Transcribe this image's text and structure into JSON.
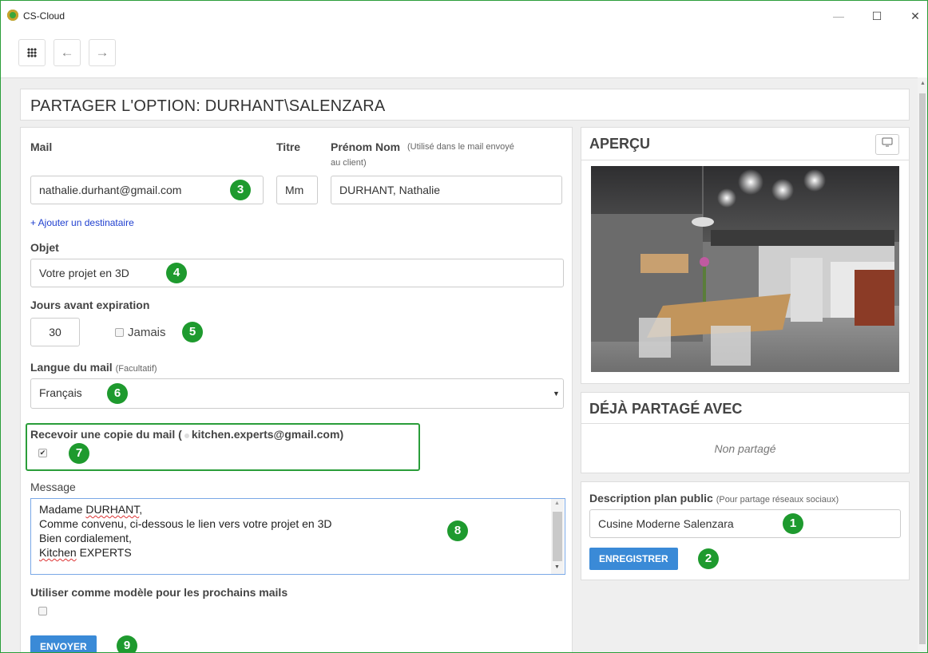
{
  "window": {
    "title": "CS-Cloud",
    "min": "—",
    "max": "☐",
    "close": "✕"
  },
  "toolbar": {
    "back": "←",
    "forward": "→"
  },
  "page": {
    "title": "PARTAGER L'OPTION: DURHANT\\SALENZARA"
  },
  "form": {
    "mail_label": "Mail",
    "titre_label": "Titre",
    "name_label": "Prénom Nom",
    "name_note": "(Utilisé dans le mail envoyé au client)",
    "mail_value": "nathalie.durhant@gmail.com",
    "titre_value": "Mm",
    "name_value": "DURHANT, Nathalie",
    "add_recipient": "+ Ajouter un destinataire",
    "objet_label": "Objet",
    "objet_value": "Votre projet en 3D",
    "expiration_label": "Jours avant expiration",
    "expiration_value": "30",
    "jamais_label": "Jamais",
    "langue_label": "Langue du mail",
    "langue_note": "(Facultatif)",
    "langue_value": "Français",
    "copy_label": "Recevoir une copie du mail (",
    "copy_email": "kitchen.experts@gmail.com",
    "copy_close": ")",
    "copy_checked": true,
    "message_label": "Message",
    "message_line1_a": "Madame ",
    "message_line1_b": "DURHANT",
    "message_line1_c": ",",
    "message_line2": "Comme convenu, ci-dessous le lien vers votre projet en 3D",
    "message_line3": "Bien cordialement,",
    "message_line4_a": "Kitchen",
    "message_line4_b": " EXPERTS",
    "template_label": "Utiliser comme modèle pour les prochains mails",
    "template_checked": false,
    "send_button": "ENVOYER"
  },
  "preview": {
    "title": "APERÇU",
    "icon": "monitor-icon"
  },
  "shared": {
    "title": "DÉJÀ PARTAGÉ AVEC",
    "empty": "Non partagé"
  },
  "description": {
    "label": "Description plan public",
    "note": "(Pour partage réseaux sociaux)",
    "value": "Cusine Moderne Salenzara",
    "save_button": "ENREGISTRER"
  },
  "badges": {
    "b1": "1",
    "b2": "2",
    "b3": "3",
    "b4": "4",
    "b5": "5",
    "b6": "6",
    "b7": "7",
    "b8": "8",
    "b9": "9"
  },
  "colors": {
    "accent": "#3a8ad7",
    "badge": "#1e9a2e",
    "link": "#1f3fcf"
  }
}
